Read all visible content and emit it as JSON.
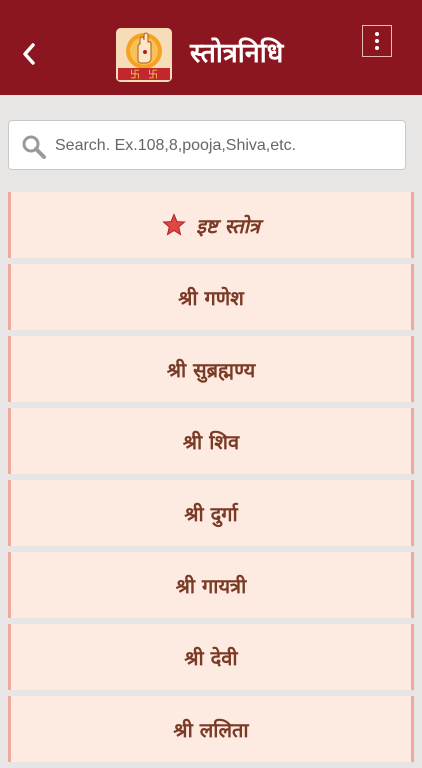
{
  "header": {
    "title": "स्तोत्रनिधि",
    "back_icon": "back-chevron-icon",
    "menu_icon": "more-vertical-icon",
    "background_color": "#8b1620"
  },
  "search": {
    "placeholder": "Search. Ex.108,8,pooja,Shiva,etc.",
    "value": ""
  },
  "list": {
    "items": [
      {
        "label": "इष्ट स्तोत्र",
        "icon": "star-icon"
      },
      {
        "label": "श्री गणेश"
      },
      {
        "label": "श्री सुब्रह्मण्य"
      },
      {
        "label": "श्री शिव"
      },
      {
        "label": "श्री दुर्गा"
      },
      {
        "label": "श्री गायत्री"
      },
      {
        "label": "श्री देवी"
      },
      {
        "label": "श्री ललिता"
      }
    ],
    "item_background": "#fdebe1",
    "item_border_color": "#f1a99e",
    "text_color": "#7a3a26"
  }
}
